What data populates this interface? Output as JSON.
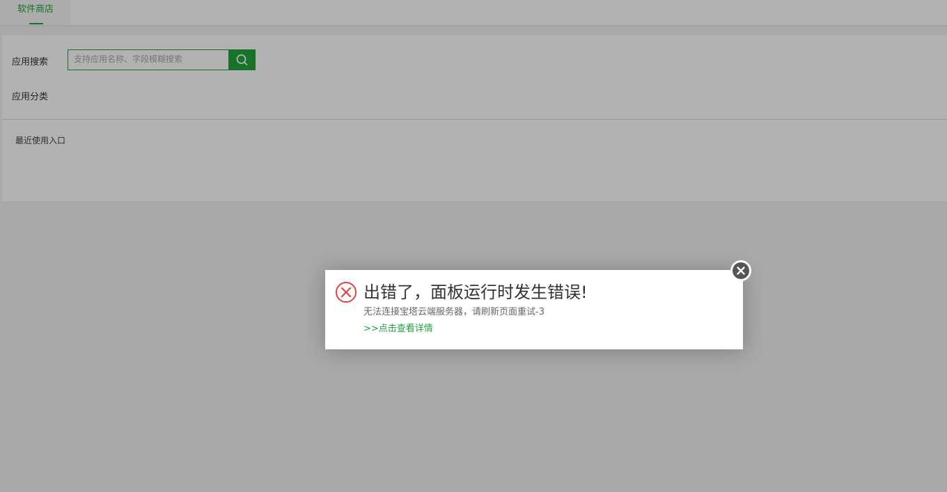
{
  "tabs": [
    {
      "label": "软件商店",
      "active": true
    }
  ],
  "search": {
    "label": "应用搜索",
    "placeholder": "支持应用名称、字段模糊搜索",
    "value": "",
    "button_icon": "search-icon"
  },
  "category": {
    "label": "应用分类"
  },
  "recent": {
    "label": "最近使用入口"
  },
  "dialog": {
    "icon": "error-circle-icon",
    "title": "出错了，面板运行时发生错误!",
    "message": "无法连接宝塔云端服务器，请刷新页面重试-3",
    "link": ">>点击查看详情",
    "close_icon": "close-icon"
  },
  "colors": {
    "accent": "#20a53a",
    "error": "#e8423c",
    "overlay": "rgba(0,0,0,0.30)"
  }
}
